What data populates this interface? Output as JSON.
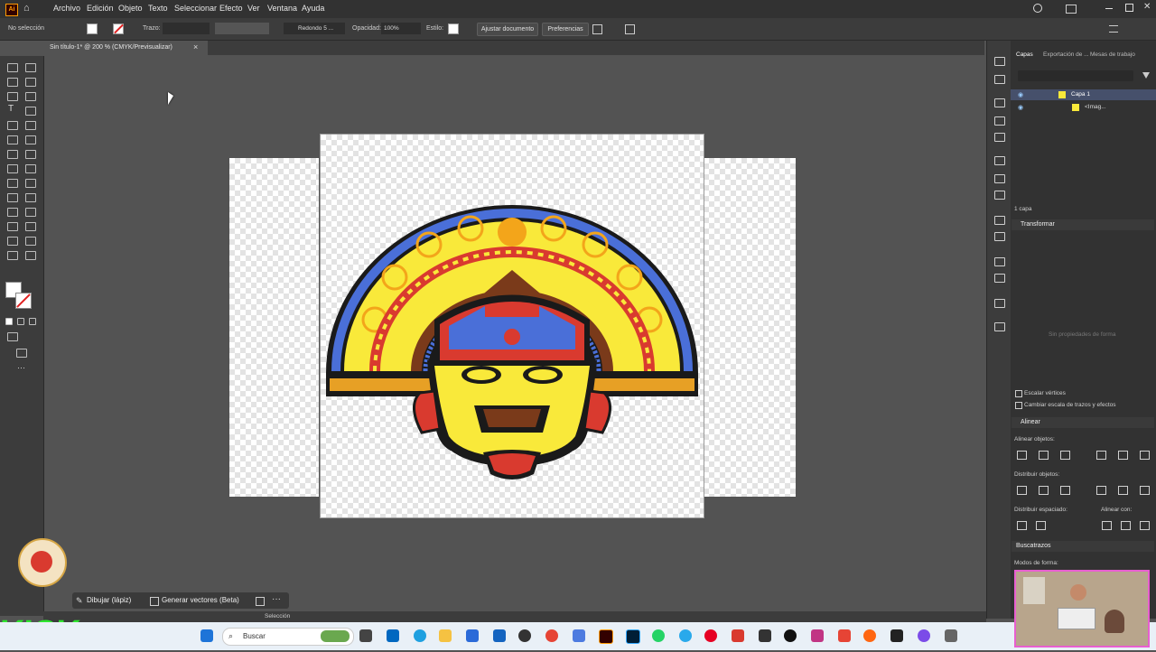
{
  "menubar": {
    "logo": "Ai",
    "items": [
      "Archivo",
      "Edición",
      "Objeto",
      "Texto",
      "Seleccionar",
      "Efecto",
      "Ver",
      "Ventana",
      "Ayuda"
    ]
  },
  "control": {
    "selection_state": "No selección",
    "stroke_label": "Trazo:",
    "brush": "Redondo 5 ...",
    "opacity_label": "Opacidad:",
    "opacity_value": "100%",
    "style_label": "Estilo:",
    "fit_button": "Ajustar documento",
    "prefs_button": "Preferencias"
  },
  "document": {
    "tab_title": "Sin título-1* @ 200 % (CMYK/Previsualizar)"
  },
  "panels": {
    "tabs": [
      "Capas",
      "Exportación de ...",
      "Mesas de trabajo"
    ],
    "layers": [
      {
        "name": "Capa 1"
      },
      {
        "name": "<Imag..."
      }
    ],
    "layer_count": "1 capa",
    "transform_title": "Transformar",
    "no_props": "Sin propiedades de forma",
    "scale_corners": "Escalar vértices",
    "scale_strokes": "Cambiar escala de trazos y efectos",
    "align_title": "Alinear",
    "align_objects": "Alinear objetos:",
    "distribute_objects": "Distribuir objetos:",
    "distribute_spacing": "Distribuir espaciado:",
    "align_to": "Alinear con:",
    "pathfinder_title": "Buscatrazos",
    "shape_modes": "Modos de forma:"
  },
  "floating": {
    "draw_label": "Dibujar (lápiz)",
    "generate_label": "Generar vectores (Beta)"
  },
  "status": {
    "tool": "Selección"
  },
  "taskbar": {
    "search_placeholder": "Buscar",
    "badge": "KICK"
  },
  "colors": {
    "accent": "#ff9a00",
    "ui_dark": "#323232",
    "ui_mid": "#3c3c3c",
    "canvas": "#535353"
  }
}
